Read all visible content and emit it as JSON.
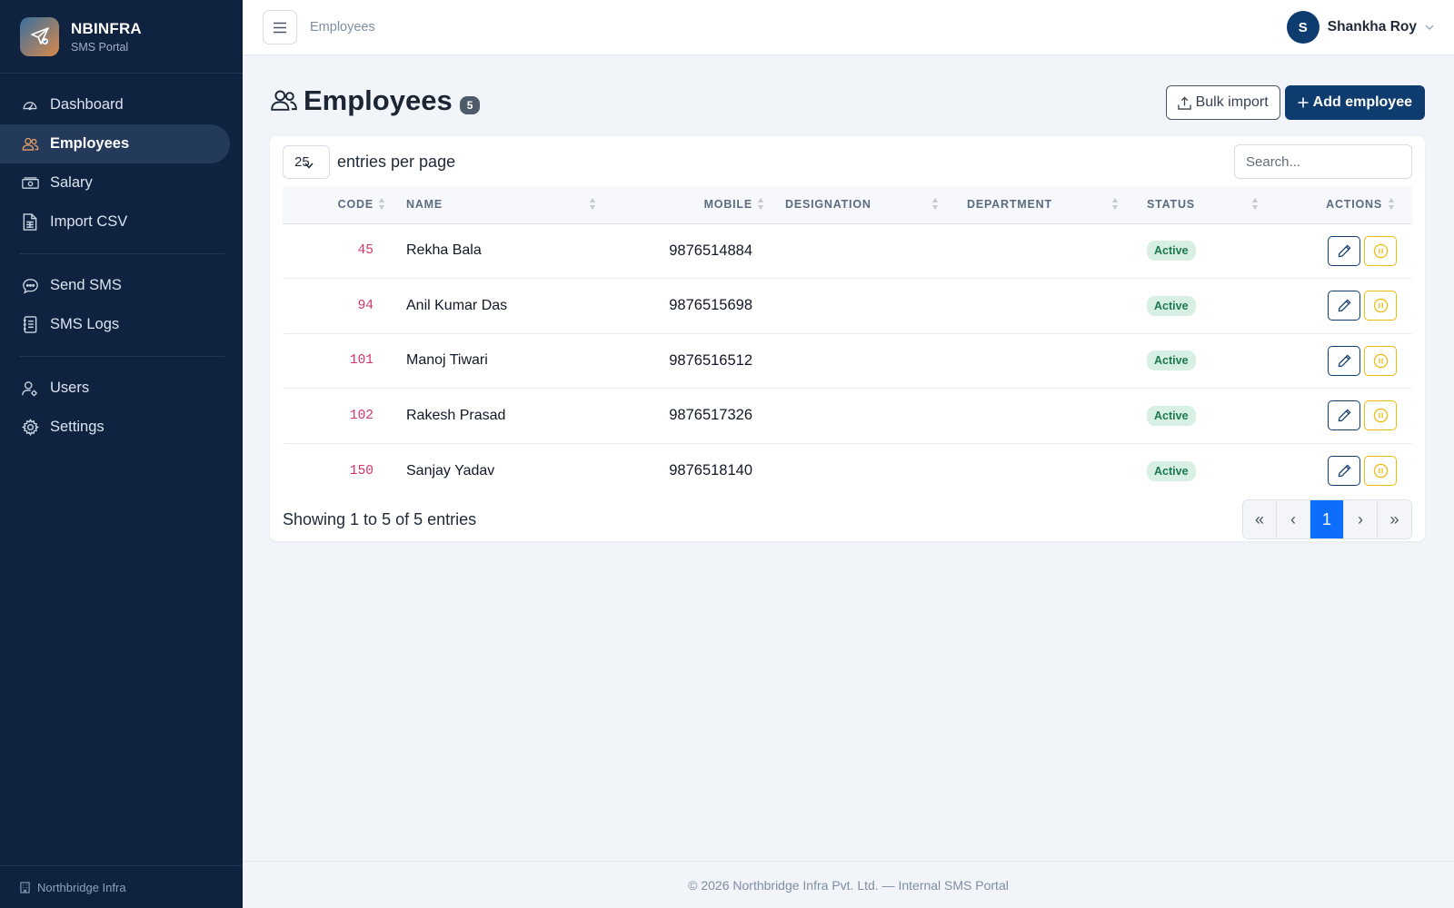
{
  "brand": {
    "name": "NBINFRA",
    "subtitle": "SMS Portal"
  },
  "sidebar": {
    "items": [
      {
        "label": "Dashboard",
        "icon": "gauge-icon"
      },
      {
        "label": "Employees",
        "icon": "people-icon",
        "active": true
      },
      {
        "label": "Salary",
        "icon": "cash-icon"
      },
      {
        "label": "Import CSV",
        "icon": "spreadsheet-icon"
      },
      {
        "label": "Send SMS",
        "icon": "chat-icon"
      },
      {
        "label": "SMS Logs",
        "icon": "journal-icon"
      },
      {
        "label": "Users",
        "icon": "user-gear-icon"
      },
      {
        "label": "Settings",
        "icon": "gear-icon"
      }
    ],
    "footer": "Northbridge Infra"
  },
  "topbar": {
    "breadcrumb": "Employees",
    "user_initial": "S",
    "user_name": "Shankha Roy"
  },
  "page": {
    "title": "Employees",
    "count": "5",
    "bulk_import_label": "Bulk import",
    "add_employee_label": "Add employee"
  },
  "table": {
    "per_page_value": "25",
    "per_page_label": "entries per page",
    "search_placeholder": "Search...",
    "columns": [
      "Code",
      "Name",
      "Mobile",
      "Designation",
      "Department",
      "Status",
      "Actions"
    ],
    "rows": [
      {
        "code": "45",
        "name": "Rekha Bala",
        "mobile": "9876514884",
        "designation": "",
        "department": "",
        "status": "Active"
      },
      {
        "code": "94",
        "name": "Anil Kumar Das",
        "mobile": "9876515698",
        "designation": "",
        "department": "",
        "status": "Active"
      },
      {
        "code": "101",
        "name": "Manoj Tiwari",
        "mobile": "9876516512",
        "designation": "",
        "department": "",
        "status": "Active"
      },
      {
        "code": "102",
        "name": "Rakesh Prasad",
        "mobile": "9876517326",
        "designation": "",
        "department": "",
        "status": "Active"
      },
      {
        "code": "150",
        "name": "Sanjay Yadav",
        "mobile": "9876518140",
        "designation": "",
        "department": "",
        "status": "Active"
      }
    ],
    "showing": "Showing 1 to 5 of 5 entries",
    "pager": [
      "«",
      "‹",
      "1",
      "›",
      "»"
    ],
    "current_page": "1"
  },
  "footer": "© 2026 Northbridge Infra Pvt. Ltd. — Internal SMS Portal",
  "colors": {
    "sidebar_bg": "#0f2240",
    "primary": "#0f3c6e",
    "page_active": "#0d6efd",
    "code_text": "#d6336c",
    "status_bg": "#d8efe4",
    "status_text": "#1c7a4d",
    "pause_border": "#f0b90b"
  }
}
